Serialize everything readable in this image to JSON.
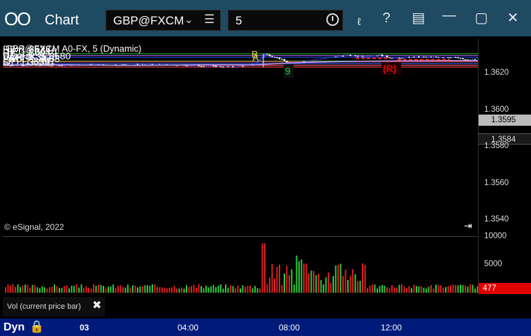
{
  "titlebar": {
    "app_title": "Chart",
    "symbol": "GBP@FXCM",
    "interval": "5"
  },
  "pane": {
    "title": "GBP@FXCM A0-FX, 5 (Dynamic)",
    "copyright": "© eSignal, 2022"
  },
  "levels": [
    {
      "label": "R2: 1.3628",
      "price": 1.3628,
      "color": "#2ecc40"
    },
    {
      "label": "UPT: 1.3616",
      "price": 1.3616,
      "color": "#b06cff"
    },
    {
      "label": "R1: 1.3604",
      "price": 1.3604,
      "color": "#2a4dff"
    },
    {
      "label": "UBreak: 1.3580",
      "price": 1.358,
      "color": "#2ecc40"
    },
    {
      "label": "VAH: 1.3576",
      "price": 1.3576,
      "color": "#ff3b3b"
    },
    {
      "label": "Pivot: 1.3563",
      "price": 1.3563,
      "color": "#2a4dff"
    },
    {
      "label": "LPT: 1.3551",
      "price": 1.3551,
      "color": "#ff3b3b"
    },
    {
      "label": "S1: 1.3539",
      "price": 1.3539,
      "color": "#ff3b3b"
    }
  ],
  "price_axis": {
    "ticks": [
      "1.3620",
      "1.3600",
      "1.3580",
      "1.3560",
      "1.3540"
    ],
    "last_price": "1.3595",
    "ma_price": "1.3584"
  },
  "vol_axis": {
    "ticks": [
      "10000",
      "5000"
    ],
    "last_volume": "477"
  },
  "vol_pane": {
    "label": "Vol (current price bar)"
  },
  "timebar": {
    "mode": "Dyn",
    "labels": [
      "03",
      "04:00",
      "08:00",
      "12:00"
    ]
  },
  "annotations": {
    "b": "B",
    "a": "A",
    "r": "(R)",
    "nine": "9"
  },
  "colors": {
    "titlebar": "#1e4a62",
    "timebar": "#001a7a",
    "up_bar": "#2a4dff",
    "down_bar": "#ffffff",
    "ma": "#b89cff"
  }
}
